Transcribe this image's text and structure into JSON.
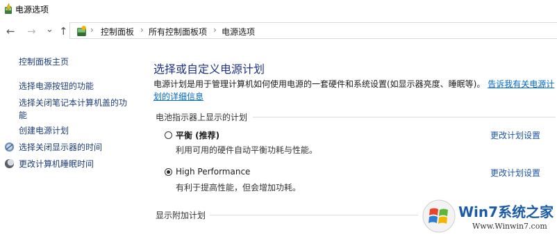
{
  "window": {
    "title": "电源选项"
  },
  "nav": {
    "back": "←",
    "forward": "→",
    "recent": "⌄",
    "up": "↑"
  },
  "breadcrumb": {
    "sep": "›",
    "items": [
      "控制面板",
      "所有控制面板项",
      "电源选项"
    ]
  },
  "sidebar": {
    "home": "控制面板主页",
    "items": [
      {
        "label": "选择电源按钮的功能"
      },
      {
        "label_line1": "选择关闭笔记本计算机盖的功",
        "label_line2": "能"
      },
      {
        "label": "创建电源计划"
      },
      {
        "label": "选择关闭显示器的时间",
        "icon": "monitor-icon"
      },
      {
        "label": "更改计算机睡眠时间",
        "icon": "moon-icon"
      }
    ]
  },
  "main": {
    "heading": "选择或自定义电源计划",
    "description": "电源计划是用于管理计算机如何使用电源的一套硬件和系统设置(如显示器亮度、睡眠等)。",
    "learn_more_line1": "告诉我有关电源计",
    "learn_more_line2": "划的详细信息",
    "battery_section": "电池指示器上显示的计划",
    "plans": [
      {
        "name": "平衡 (推荐)",
        "desc": "利用可用的硬件自动平衡功耗与性能。",
        "selected": false,
        "link": "更改计划设置"
      },
      {
        "name": "High Performance",
        "desc": "有利于提高性能，但会增加功耗。",
        "selected": true,
        "link": "更改计划设置"
      }
    ],
    "additional_section": "显示附加计划"
  },
  "watermark": {
    "brand": "Win7系统之家",
    "url": "Www.Winwin7.com"
  },
  "colors": {
    "accent": "#1e3287",
    "link": "#1c3e78",
    "learn_more": "#0066cc"
  }
}
